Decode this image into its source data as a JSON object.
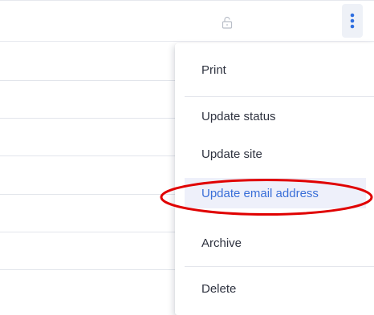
{
  "toolbar": {
    "lock_icon": "lock-open-icon",
    "more_icon": "kebab-vertical-icon",
    "accent_color": "#2f6fe0"
  },
  "menu": {
    "items": [
      {
        "label": "Print"
      },
      {
        "label": "Update status"
      },
      {
        "label": "Update site"
      },
      {
        "label": "Update email address",
        "active": true
      },
      {
        "label": "Archive"
      },
      {
        "label": "Delete"
      }
    ]
  },
  "annotation": {
    "ellipse_color": "#e00000",
    "highlighted_item": "Update email address"
  }
}
